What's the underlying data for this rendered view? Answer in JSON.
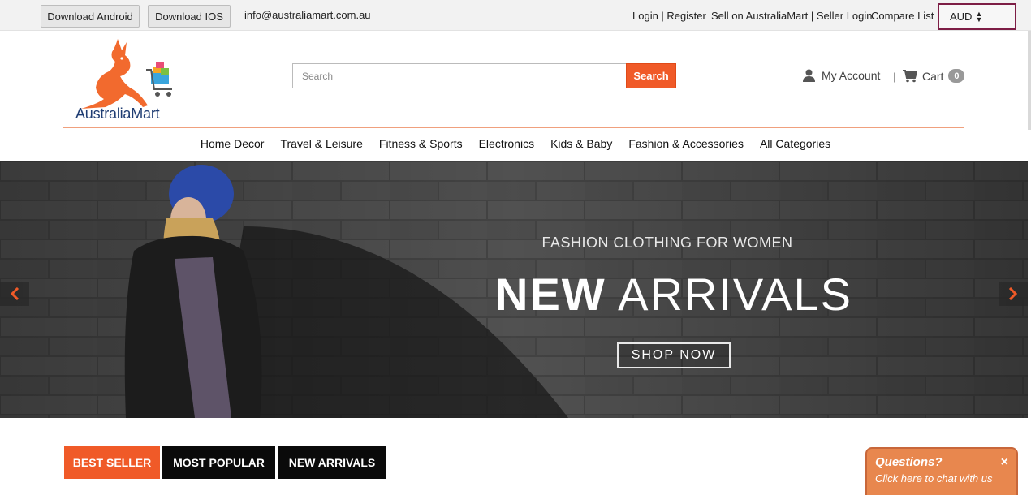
{
  "topbar": {
    "download_android": "Download Android",
    "download_ios": "Download IOS",
    "email": "info@australiamart.com.au",
    "login": "Login",
    "register": "Register",
    "sell": "Sell on AustraliaMart",
    "seller_login": "Seller Login",
    "compare": "Compare List",
    "currency": "AUD",
    "separator": " | "
  },
  "header": {
    "logo_text": "AustraliaMart",
    "search_placeholder": "Search",
    "search_button": "Search",
    "my_account": "My Account",
    "divider": "|",
    "cart_label": "Cart",
    "cart_count": "0"
  },
  "nav": {
    "items": [
      "Home Decor",
      "Travel & Leisure",
      "Fitness & Sports",
      "Electronics",
      "Kids & Baby",
      "Fashion & Accessories",
      "All Categories"
    ]
  },
  "hero": {
    "subtitle": "FASHION CLOTHING FOR WOMEN",
    "title_bold": "NEW",
    "title_thin": "ARRIVALS",
    "cta": "SHOP NOW"
  },
  "tabs": {
    "items": [
      "BEST SELLER",
      "MOST POPULAR",
      "NEW ARRIVALS"
    ],
    "active": "BEST SELLER"
  },
  "chat": {
    "title": "Questions?",
    "subtitle": "Click here to chat with us",
    "close": "×"
  },
  "colors": {
    "accent": "#f05a28",
    "currency_border": "#7d1d45",
    "chat": "#e8874e",
    "logo_blue": "#1f3d73"
  }
}
